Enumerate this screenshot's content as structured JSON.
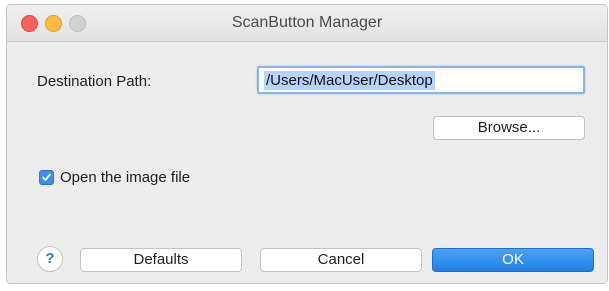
{
  "window": {
    "title": "ScanButton Manager",
    "traffic_lights": {
      "close_color": "#fc605b",
      "minimize_color": "#fdbc40",
      "zoom_color": "#d2d2d2"
    }
  },
  "destination": {
    "label": "Destination Path:",
    "value": "/Users/MacUser/Desktop",
    "browse_label": "Browse..."
  },
  "options": {
    "open_image_label": "Open the image file",
    "open_image_checked": true
  },
  "footer": {
    "help_symbol": "?",
    "defaults_label": "Defaults",
    "cancel_label": "Cancel",
    "ok_label": "OK",
    "ok_color": "#2b86ee"
  },
  "icons": {
    "help": "help-icon",
    "checkmark": "checkmark-icon"
  }
}
